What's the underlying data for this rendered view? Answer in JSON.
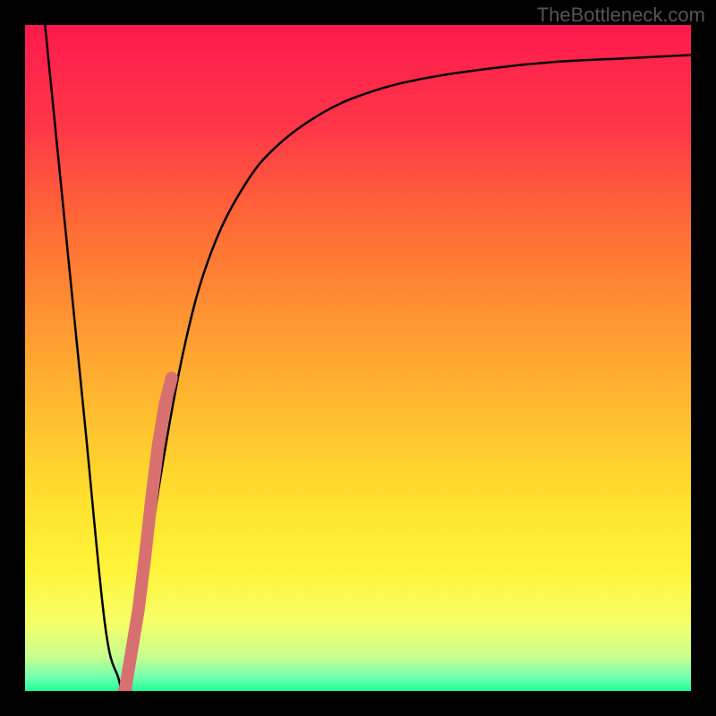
{
  "watermark": "TheBottleneck.com",
  "chart_data": {
    "type": "line",
    "title": "",
    "xlabel": "",
    "ylabel": "",
    "ylim": [
      0,
      100
    ],
    "xlim": [
      0,
      100
    ],
    "main_curve": {
      "name": "bottleneck-curve",
      "x": [
        3,
        6,
        9,
        12,
        14,
        15,
        17,
        20,
        24,
        28,
        33,
        38,
        45,
        52,
        60,
        70,
        80,
        90,
        100
      ],
      "y": [
        100,
        70,
        40,
        10,
        2,
        0,
        8,
        30,
        52,
        66,
        76,
        82,
        87,
        90,
        92,
        93.5,
        94.5,
        95,
        95.5
      ],
      "color": "#000000"
    },
    "highlight_segment": {
      "name": "highlight",
      "x": [
        15,
        16,
        17,
        18,
        19,
        20,
        21,
        22
      ],
      "y": [
        0,
        6,
        12,
        20,
        29,
        37,
        43,
        47
      ],
      "color": "#d87070"
    },
    "background_gradient": {
      "orientation": "vertical",
      "stops": [
        {
          "offset": 0,
          "color": "#ff1a4d"
        },
        {
          "offset": 15,
          "color": "#ff3648"
        },
        {
          "offset": 30,
          "color": "#ff6a36"
        },
        {
          "offset": 45,
          "color": "#ff9832"
        },
        {
          "offset": 60,
          "color": "#ffc22f"
        },
        {
          "offset": 72,
          "color": "#ffe22e"
        },
        {
          "offset": 82,
          "color": "#fff53a"
        },
        {
          "offset": 90,
          "color": "#f5ff6a"
        },
        {
          "offset": 95,
          "color": "#c5ff90"
        },
        {
          "offset": 98,
          "color": "#70ffb0"
        },
        {
          "offset": 100,
          "color": "#20ff95"
        }
      ]
    }
  }
}
